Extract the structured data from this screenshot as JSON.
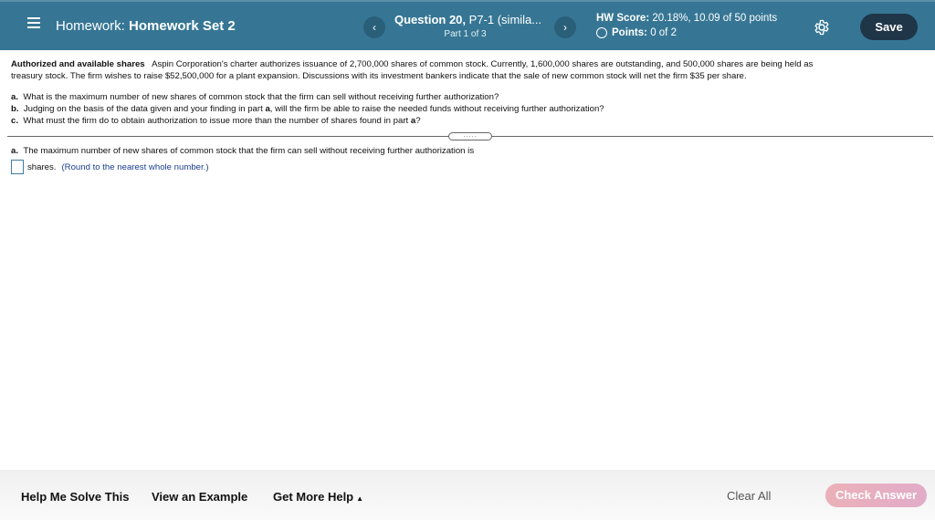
{
  "header": {
    "menu_icon": "hamburger-menu-icon",
    "homework_prefix": "Homework:",
    "homework_name": "Homework Set 2",
    "prev_icon": "‹",
    "next_icon": "›",
    "question_bold": "Question 20,",
    "question_rest": "P7-1 (simila...",
    "part": "Part 1 of 3",
    "score_label": "HW Score:",
    "score_value": "20.18%, 10.09 of 50 points",
    "points_label": "Points:",
    "points_value": "0 of 2",
    "settings_icon": "gear-icon",
    "save_label": "Save"
  },
  "problem": {
    "title": "Authorized and available shares",
    "intro_line1": "Aspin Corporation's charter authorizes issuance of 2,700,000 shares of common stock. Currently, 1,600,000 shares are outstanding, and 500,000 shares are being held as",
    "intro_line2": "treasury stock.  The firm wishes to raise $52,500,000 for a plant expansion. Discussions with its investment bankers indicate that the sale of new common stock will net the firm $35 per share.",
    "questions": [
      {
        "letter": "a.",
        "text": "What is the maximum number of new shares of common stock that the firm can sell without receiving further authorization?"
      },
      {
        "letter": "b.",
        "text_before": "Judging on the basis of the data given and your finding in part",
        "ref": "a",
        "text_after": ", will the firm be able to raise the needed funds without receiving further authorization?"
      },
      {
        "letter": "c.",
        "text_before": "What must the firm do to obtain authorization to issue more than the number of shares found in part",
        "ref": "a",
        "text_after": "?"
      }
    ],
    "expander_label": "....."
  },
  "answer": {
    "letter": "a.",
    "prompt": "The maximum number of new shares of common stock that the firm can sell without receiving further authorization is",
    "input_value": "",
    "unit": "shares.",
    "hint": "(Round to the nearest whole number.)"
  },
  "footer": {
    "help_solve": "Help Me Solve This",
    "view_example": "View an Example",
    "more_help": "Get More Help",
    "more_help_caret": "▲",
    "clear_all": "Clear All",
    "check_answer": "Check Answer"
  }
}
